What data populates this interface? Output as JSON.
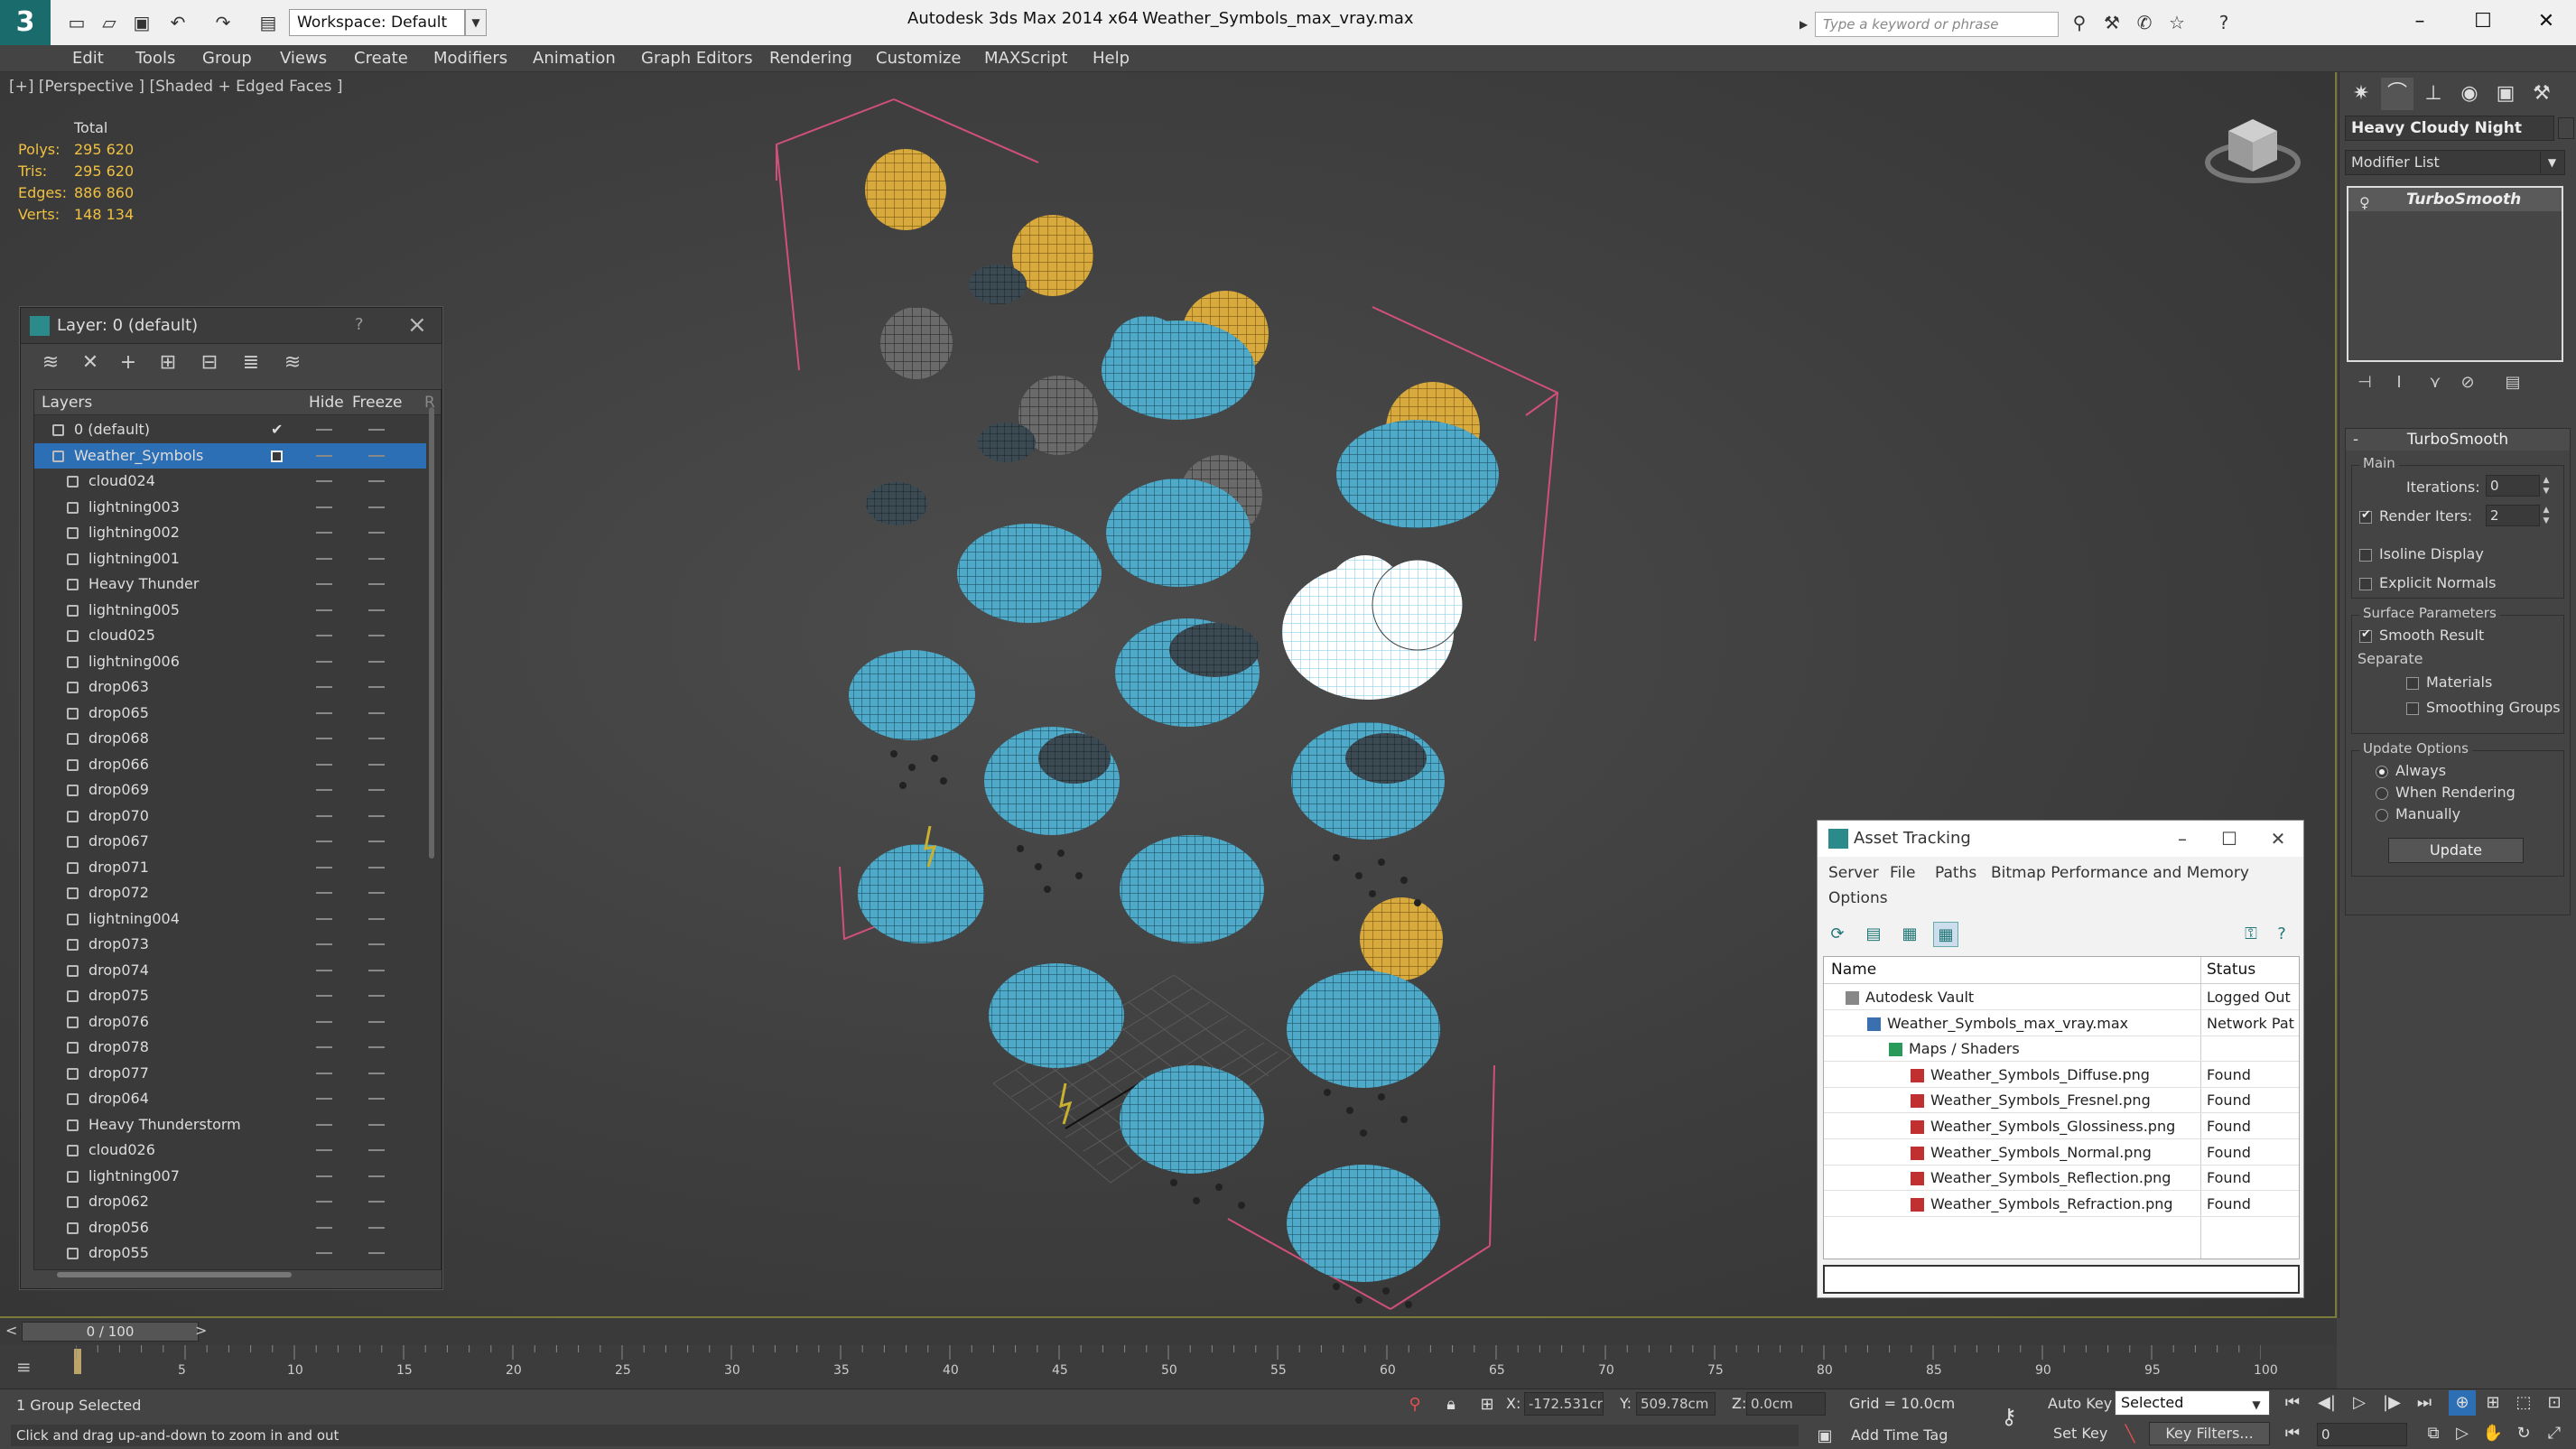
{
  "titlebar": {
    "app": "Autodesk 3ds Max  2014 x64",
    "file": "Weather_Symbols_max_vray.max",
    "workspace": "Workspace: Default",
    "search_placeholder": "Type a keyword or phrase"
  },
  "menu": [
    "Edit",
    "Tools",
    "Group",
    "Views",
    "Create",
    "Modifiers",
    "Animation",
    "Graph Editors",
    "Rendering",
    "Customize",
    "MAXScript",
    "Help"
  ],
  "viewport": {
    "label": "[+] [Perspective ] [Shaded + Edged Faces ]",
    "stats": {
      "header": "Total",
      "polys_label": "Polys:",
      "polys": "295 620",
      "tris_label": "Tris:",
      "tris": "295 620",
      "edges_label": "Edges:",
      "edges": "886 860",
      "verts_label": "Verts:",
      "verts": "148 134"
    }
  },
  "layer_panel": {
    "title": "Layer: 0 (default)",
    "help": "?",
    "col_layers": "Layers",
    "col_hide": "Hide",
    "col_freeze": "Freeze",
    "col_r": "R",
    "layers": [
      {
        "name": "0 (default)"
      },
      {
        "name": "Weather_Symbols"
      },
      {
        "name": "cloud024"
      },
      {
        "name": "lightning003"
      },
      {
        "name": "lightning002"
      },
      {
        "name": "lightning001"
      },
      {
        "name": "Heavy Thunder"
      },
      {
        "name": "lightning005"
      },
      {
        "name": "cloud025"
      },
      {
        "name": "lightning006"
      },
      {
        "name": "drop063"
      },
      {
        "name": "drop065"
      },
      {
        "name": "drop068"
      },
      {
        "name": "drop066"
      },
      {
        "name": "drop069"
      },
      {
        "name": "drop070"
      },
      {
        "name": "drop067"
      },
      {
        "name": "drop071"
      },
      {
        "name": "drop072"
      },
      {
        "name": "lightning004"
      },
      {
        "name": "drop073"
      },
      {
        "name": "drop074"
      },
      {
        "name": "drop075"
      },
      {
        "name": "drop076"
      },
      {
        "name": "drop078"
      },
      {
        "name": "drop077"
      },
      {
        "name": "drop064"
      },
      {
        "name": "Heavy Thunderstorm"
      },
      {
        "name": "cloud026"
      },
      {
        "name": "lightning007"
      },
      {
        "name": "drop062"
      },
      {
        "name": "drop056"
      },
      {
        "name": "drop055"
      }
    ]
  },
  "command_panel": {
    "object_name": "Heavy Cloudy Night",
    "modifier_list": "Modifier List",
    "stack_item": "TurboSmooth",
    "rollout_title": "TurboSmooth",
    "main_group": "Main",
    "iterations_label": "Iterations:",
    "iterations": "0",
    "render_iters_label": "Render Iters:",
    "render_iters": "2",
    "isoline": "Isoline Display",
    "explicit_normals": "Explicit Normals",
    "surface_group": "Surface Parameters",
    "smooth_result": "Smooth Result",
    "separate": "Separate",
    "materials": "Materials",
    "smoothing_groups": "Smoothing Groups",
    "update_group": "Update Options",
    "always": "Always",
    "when_rendering": "When Rendering",
    "manually": "Manually",
    "update_button": "Update"
  },
  "asset_tracking": {
    "title": "Asset Tracking",
    "menu": [
      "Server",
      "File",
      "Paths",
      "Bitmap Performance and Memory",
      "Options"
    ],
    "col_name": "Name",
    "col_status": "Status",
    "rows": [
      {
        "name": "Autodesk Vault",
        "status": "Logged Out",
        "indent": 0
      },
      {
        "name": "Weather_Symbols_max_vray.max",
        "status": "Network Pat",
        "indent": 1
      },
      {
        "name": "Maps / Shaders",
        "status": "",
        "indent": 2
      },
      {
        "name": "Weather_Symbols_Diffuse.png",
        "status": "Found",
        "indent": 3
      },
      {
        "name": "Weather_Symbols_Fresnel.png",
        "status": "Found",
        "indent": 3
      },
      {
        "name": "Weather_Symbols_Glossiness.png",
        "status": "Found",
        "indent": 3
      },
      {
        "name": "Weather_Symbols_Normal.png",
        "status": "Found",
        "indent": 3
      },
      {
        "name": "Weather_Symbols_Reflection.png",
        "status": "Found",
        "indent": 3
      },
      {
        "name": "Weather_Symbols_Refraction.png",
        "status": "Found",
        "indent": 3
      }
    ]
  },
  "timeline": {
    "slider": "0 / 100",
    "ticks": [
      "5",
      "10",
      "15",
      "20",
      "25",
      "30",
      "35",
      "40",
      "45",
      "50",
      "55",
      "60",
      "65",
      "70",
      "75",
      "80",
      "85",
      "90",
      "95",
      "100"
    ]
  },
  "status": {
    "selection": "1 Group Selected",
    "prompt": "Click and drag up-and-down to zoom in and out",
    "x_label": "X:",
    "x": "-172.531cr",
    "y_label": "Y:",
    "y": "509.78cm",
    "z_label": "Z:",
    "z": "0.0cm",
    "grid": "Grid = 10.0cm",
    "add_time_tag": "Add Time Tag",
    "auto_key": "Auto Key",
    "set_key": "Set Key",
    "selected": "Selected",
    "key_filters": "Key Filters...",
    "frame": "0"
  },
  "colors": {
    "selection_blue": "#2d6fb5",
    "stats_yellow": "#f0c040",
    "cloud_blue": "#4fa9c8",
    "sun_gold": "#d8a93c",
    "moon_gray": "#6a6a6a",
    "bbox_pink": "#d0507a"
  }
}
